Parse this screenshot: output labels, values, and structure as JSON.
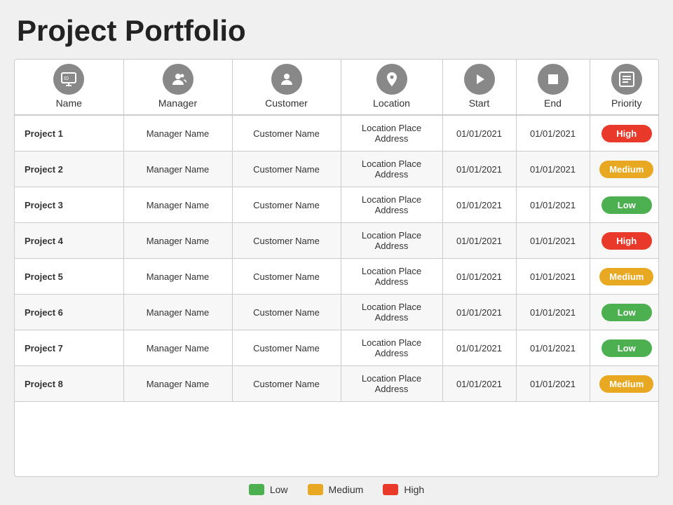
{
  "title": "Project Portfolio",
  "columns": [
    {
      "key": "name",
      "label": "Name",
      "icon": "name"
    },
    {
      "key": "manager",
      "label": "Manager",
      "icon": "manager"
    },
    {
      "key": "customer",
      "label": "Customer",
      "icon": "customer"
    },
    {
      "key": "location",
      "label": "Location",
      "icon": "location"
    },
    {
      "key": "start",
      "label": "Start",
      "icon": "start"
    },
    {
      "key": "end",
      "label": "End",
      "icon": "end"
    },
    {
      "key": "priority",
      "label": "Priority",
      "icon": "priority"
    }
  ],
  "rows": [
    {
      "name": "Project 1",
      "manager": "Manager Name",
      "customer": "Customer  Name",
      "location": "Location Place Address",
      "start": "01/01/2021",
      "end": "01/01/2021",
      "priority": "High"
    },
    {
      "name": "Project 2",
      "manager": "Manager Name",
      "customer": "Customer  Name",
      "location": "Location Place Address",
      "start": "01/01/2021",
      "end": "01/01/2021",
      "priority": "Medium"
    },
    {
      "name": "Project 3",
      "manager": "Manager Name",
      "customer": "Customer  Name",
      "location": "Location Place Address",
      "start": "01/01/2021",
      "end": "01/01/2021",
      "priority": "Low"
    },
    {
      "name": "Project 4",
      "manager": "Manager Name",
      "customer": "Customer  Name",
      "location": "Location Place Address",
      "start": "01/01/2021",
      "end": "01/01/2021",
      "priority": "High"
    },
    {
      "name": "Project 5",
      "manager": "Manager Name",
      "customer": "Customer  Name",
      "location": "Location Place Address",
      "start": "01/01/2021",
      "end": "01/01/2021",
      "priority": "Medium"
    },
    {
      "name": "Project 6",
      "manager": "Manager Name",
      "customer": "Customer  Name",
      "location": "Location Place Address",
      "start": "01/01/2021",
      "end": "01/01/2021",
      "priority": "Low"
    },
    {
      "name": "Project 7",
      "manager": "Manager Name",
      "customer": "Customer  Name",
      "location": "Location Place Address",
      "start": "01/01/2021",
      "end": "01/01/2021",
      "priority": "Low"
    },
    {
      "name": "Project 8",
      "manager": "Manager Name",
      "customer": "Customer  Name",
      "location": "Location Place Address",
      "start": "01/01/2021",
      "end": "01/01/2021",
      "priority": "Medium"
    }
  ],
  "legend": [
    {
      "label": "Low",
      "color": "low"
    },
    {
      "label": "Medium",
      "color": "medium"
    },
    {
      "label": "High",
      "color": "high"
    }
  ]
}
